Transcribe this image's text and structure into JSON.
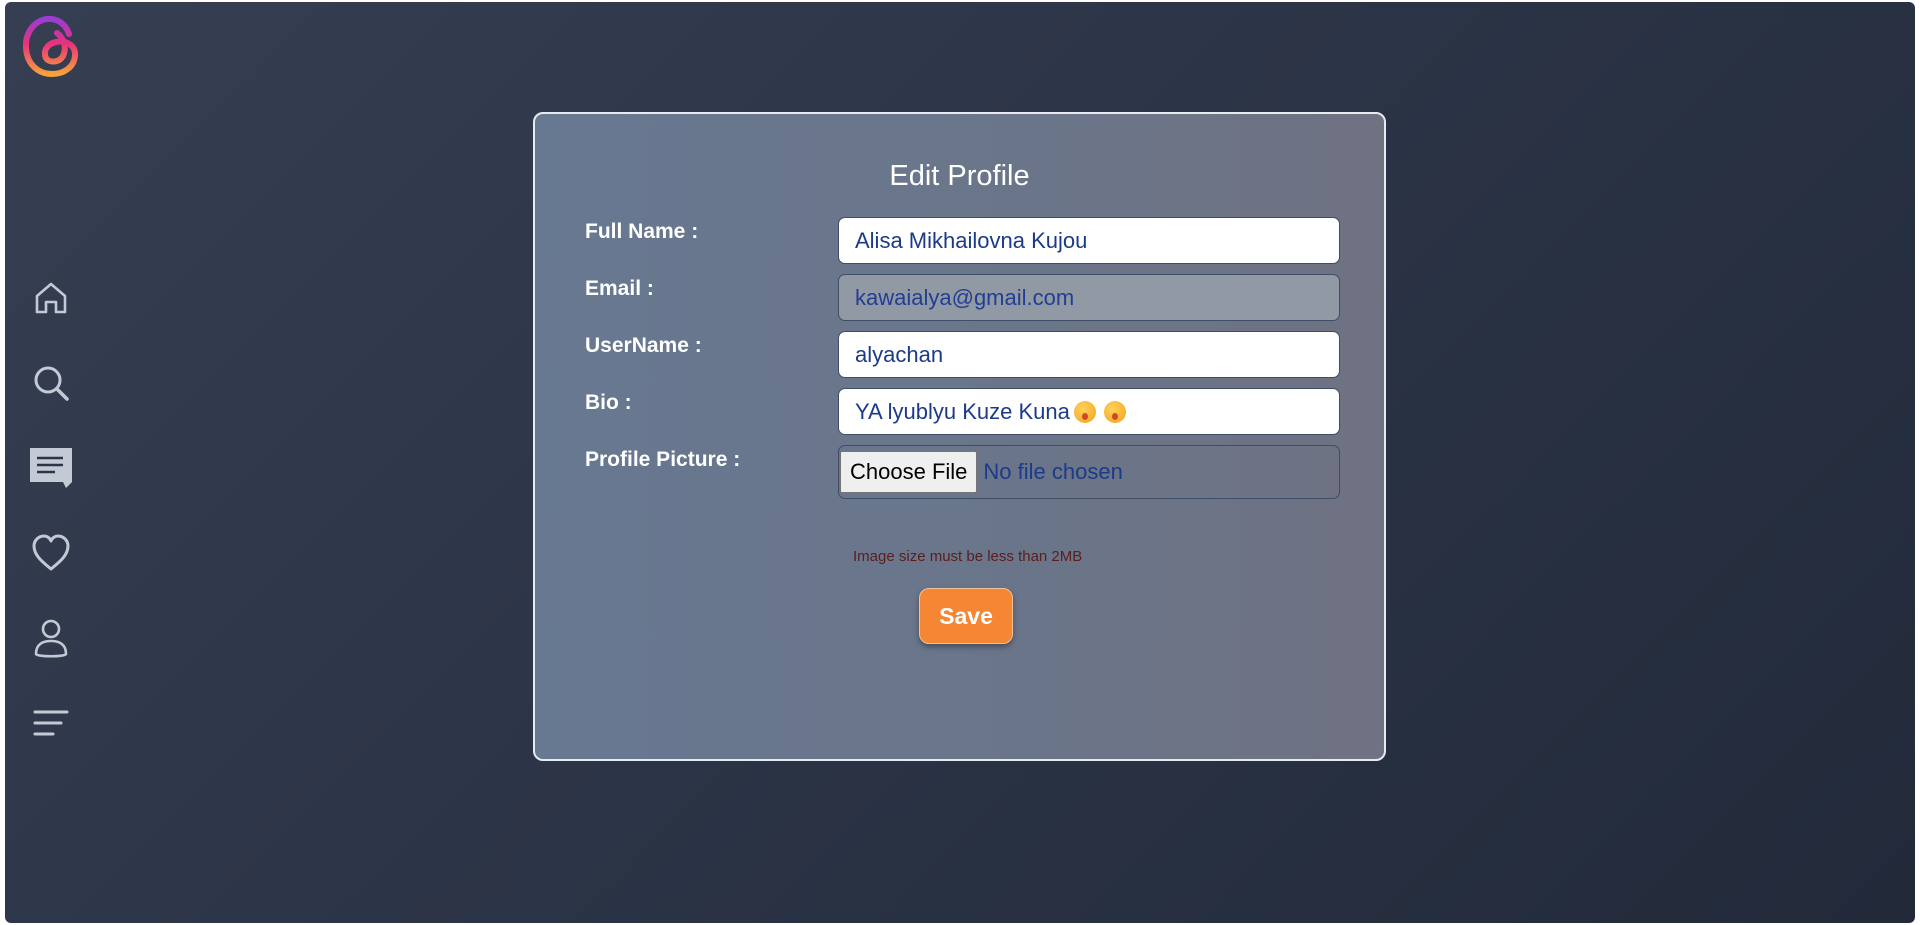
{
  "app": {
    "logo_icon": "threads-logo-icon"
  },
  "sidebar": {
    "items": [
      {
        "icon": "home-icon"
      },
      {
        "icon": "search-icon"
      },
      {
        "icon": "chat-icon"
      },
      {
        "icon": "heart-icon"
      },
      {
        "icon": "profile-icon"
      },
      {
        "icon": "menu-icon"
      }
    ]
  },
  "form": {
    "title": "Edit Profile",
    "full_name": {
      "label": "Full Name :",
      "value": "Alisa Mikhailovna Kujou"
    },
    "email": {
      "label": "Email :",
      "value": "kawaialya@gmail.com"
    },
    "username": {
      "label": "UserName :",
      "value": "alyachan"
    },
    "bio": {
      "label": "Bio :",
      "value": "YA lyublyu Kuze Kuna",
      "emoji_icons": [
        "face-emoji-icon",
        "face-emoji-icon"
      ]
    },
    "profile_picture": {
      "label": "Profile Picture :",
      "button_label": "Choose File",
      "status": "No file chosen"
    },
    "hint": "Image size must be less than 2MB",
    "save_label": "Save"
  },
  "colors": {
    "background": "#2c3547",
    "card": "#6b7589",
    "accent_button": "#f58634",
    "input_text": "#1c3a8a"
  }
}
